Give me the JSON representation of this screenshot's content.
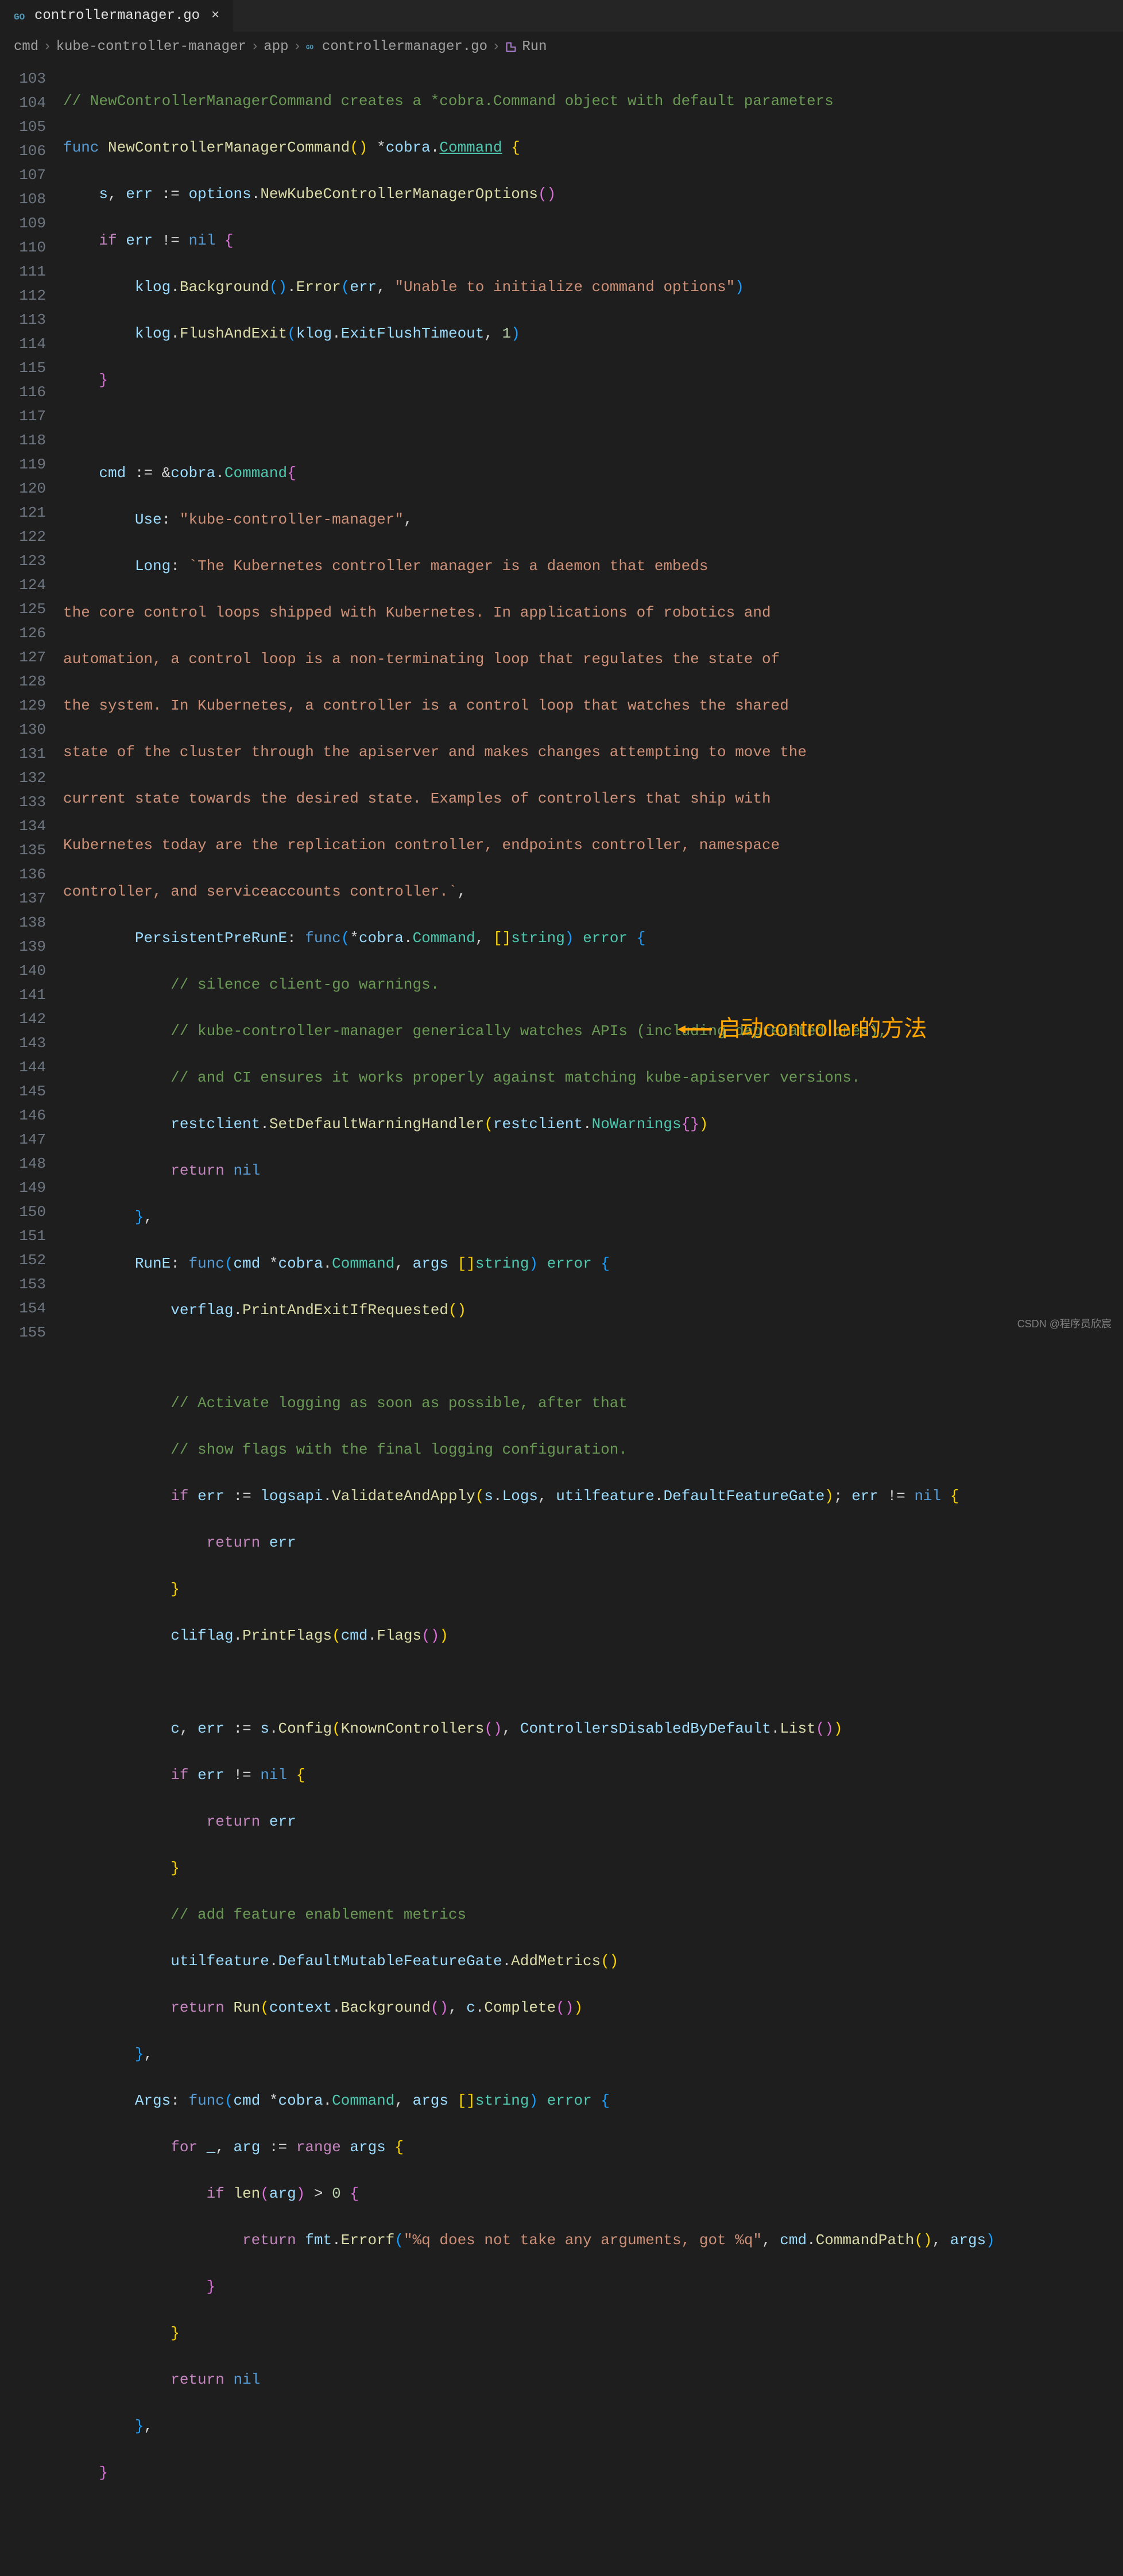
{
  "tab": {
    "filename": "controllermanager.go"
  },
  "breadcrumb": {
    "parts": [
      "cmd",
      "kube-controller-manager",
      "app",
      "controllermanager.go",
      "Run"
    ]
  },
  "gutter": {
    "start": 103,
    "end": 155
  },
  "annotation": {
    "text": "启动controller的方法"
  },
  "watermark": "CSDN @程序员欣宸",
  "code": {
    "l103": "// NewControllerManagerCommand creates a *cobra.Command object with default parameters",
    "l104_func": "func",
    "l104_name": "NewControllerManagerCommand",
    "l104_ret": "cobra",
    "l104_cmd": "Command",
    "l105_s": "s",
    "l105_err": "err",
    "l105_opt": "options",
    "l105_fn": "NewKubeControllerManagerOptions",
    "l106_if": "if",
    "l106_err": "err",
    "l106_nil": "nil",
    "l107_klog": "klog",
    "l107_bg": "Background",
    "l107_error": "Error",
    "l107_errv": "err",
    "l107_msg": "\"Unable to initialize command options\"",
    "l108_klog": "klog",
    "l108_fe": "FlushAndExit",
    "l108_klog2": "klog",
    "l108_eft": "ExitFlushTimeout",
    "l108_one": "1",
    "l111_cmd": "cmd",
    "l111_cobra": "cobra",
    "l111_Command": "Command",
    "l112_use": "Use",
    "l112_str": "\"kube-controller-manager\"",
    "l113_long": "Long",
    "l113_str": "`The Kubernetes controller manager is a daemon that embeds",
    "l114": "the core control loops shipped with Kubernetes. In applications of robotics and",
    "l115": "automation, a control loop is a non-terminating loop that regulates the state of",
    "l116": "the system. In Kubernetes, a controller is a control loop that watches the shared",
    "l117": "state of the cluster through the apiserver and makes changes attempting to move the",
    "l118": "current state towards the desired state. Examples of controllers that ship with",
    "l119": "Kubernetes today are the replication controller, endpoints controller, namespace",
    "l120": "controller, and serviceaccounts controller.`",
    "l121_ppr": "PersistentPreRunE",
    "l121_func": "func",
    "l121_cobra": "cobra",
    "l121_Command": "Command",
    "l121_string": "string",
    "l121_error": "error",
    "l122": "// silence client-go warnings.",
    "l123": "// kube-controller-manager generically watches APIs (including deprecated ones),",
    "l124": "// and CI ensures it works properly against matching kube-apiserver versions.",
    "l125_rc": "restclient",
    "l125_sdwh": "SetDefaultWarningHandler",
    "l125_rc2": "restclient",
    "l125_nw": "NoWarnings",
    "l126_return": "return",
    "l126_nil": "nil",
    "l128_rune": "RunE",
    "l128_func": "func",
    "l128_cmd": "cmd",
    "l128_cobra": "cobra",
    "l128_Command": "Command",
    "l128_args": "args",
    "l128_string": "string",
    "l128_error": "error",
    "l129_vf": "verflag",
    "l129_pae": "PrintAndExitIfRequested",
    "l131": "// Activate logging as soon as possible, after that",
    "l132": "// show flags with the final logging configuration.",
    "l133_if": "if",
    "l133_err": "err",
    "l133_la": "logsapi",
    "l133_vaa": "ValidateAndApply",
    "l133_s": "s",
    "l133_logs": "Logs",
    "l133_uf": "utilfeature",
    "l133_dfg": "DefaultFeatureGate",
    "l133_err2": "err",
    "l133_nil": "nil",
    "l134_return": "return",
    "l134_err": "err",
    "l136_cf": "cliflag",
    "l136_pf": "PrintFlags",
    "l136_cmd": "cmd",
    "l136_flags": "Flags",
    "l138_c": "c",
    "l138_err": "err",
    "l138_s": "s",
    "l138_config": "Config",
    "l138_kc": "KnownControllers",
    "l138_cdbd": "ControllersDisabledByDefault",
    "l138_list": "List",
    "l139_if": "if",
    "l139_err": "err",
    "l139_nil": "nil",
    "l140_return": "return",
    "l140_err": "err",
    "l142": "// add feature enablement metrics",
    "l143_uf": "utilfeature",
    "l143_dmfg": "DefaultMutableFeatureGate",
    "l143_am": "AddMetrics",
    "l144_return": "return",
    "l144_run": "Run",
    "l144_ctx": "context",
    "l144_bg": "Background",
    "l144_c": "c",
    "l144_complete": "Complete",
    "l146_args": "Args",
    "l146_func": "func",
    "l146_cmd": "cmd",
    "l146_cobra": "cobra",
    "l146_Command": "Command",
    "l146_argsv": "args",
    "l146_string": "string",
    "l146_error": "error",
    "l147_for": "for",
    "l147_arg": "arg",
    "l147_range": "range",
    "l147_args": "args",
    "l148_if": "if",
    "l148_len": "len",
    "l148_arg": "arg",
    "l148_zero": "0",
    "l149_return": "return",
    "l149_fmt": "fmt",
    "l149_ef": "Errorf",
    "l149_str": "\"%q does not take any arguments, got %q\"",
    "l149_cmd": "cmd",
    "l149_cp": "CommandPath",
    "l149_args": "args",
    "l152_return": "return",
    "l152_nil": "nil"
  }
}
